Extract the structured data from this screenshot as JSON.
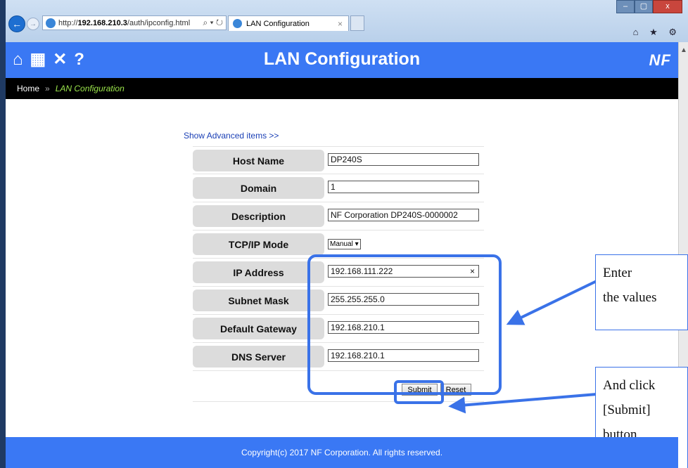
{
  "browser": {
    "url_prefix": "http://",
    "url_host": "192.168.210.3",
    "url_path": "/auth/ipconfig.html",
    "url_controls": "⌕ ▾ ↻",
    "tab_title": "LAN Configuration",
    "tab_close": "×",
    "window_buttons": [
      "–",
      "▢",
      "x"
    ],
    "toolbar_icons": "⌂ ★ ⚙"
  },
  "header": {
    "title": "LAN Configuration",
    "icons": [
      "home-icon",
      "grid-icon",
      "tools-icon",
      "help-icon"
    ],
    "icon_glyphs": [
      "⌂",
      "▦",
      "✕",
      "?"
    ],
    "logo_text": "NF",
    "accent_color": "#3a78f4"
  },
  "breadcrumb": {
    "home": "Home",
    "separator": "»",
    "current": "LAN Configuration"
  },
  "form": {
    "advanced_link": "Show Advanced items >>",
    "fields": [
      {
        "label": "Host Name",
        "value": "DP240S"
      },
      {
        "label": "Domain",
        "value": "1"
      },
      {
        "label": "Description",
        "value": "NF Corporation DP240S-0000002"
      },
      {
        "label": "TCP/IP Mode",
        "value": "Manual"
      },
      {
        "label": "IP Address",
        "value": "192.168.111.222"
      },
      {
        "label": "Subnet Mask",
        "value": "255.255.255.0"
      },
      {
        "label": "Default Gateway",
        "value": "192.168.210.1"
      },
      {
        "label": "DNS Server",
        "value": "192.168.210.1"
      }
    ],
    "tcpip_dropdown_glyph": "▾",
    "clear_glyph": "×",
    "submit_label": "Submit",
    "reset_label": "Reset"
  },
  "annotations": {
    "callout_enter_line1": "Enter",
    "callout_enter_line2": "the values",
    "callout_click_line1": "And click",
    "callout_click_line2": "[Submit]",
    "callout_click_line3": "button"
  },
  "footer": {
    "copyright": "Copyright(c) 2017 NF Corporation. All rights reserved."
  }
}
